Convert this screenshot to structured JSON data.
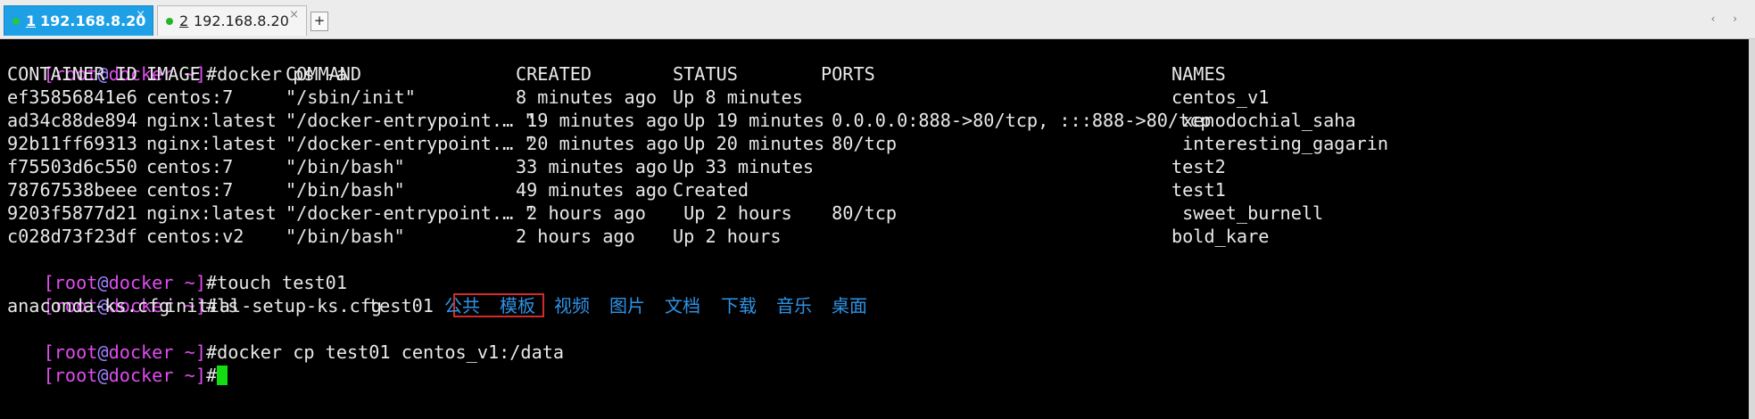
{
  "tabs": [
    {
      "number": "1",
      "host": "192.168.8.20",
      "close": "×"
    },
    {
      "number": "2",
      "host": "192.168.8.20",
      "close": "×"
    }
  ],
  "new_tab": "+",
  "tab_nav": "‹ ›",
  "colors": {
    "prompt": "#e04cf0",
    "dir_listing": "#2e93e6",
    "cursor": "#11dd11",
    "active_tab": "#1ea0e6",
    "highlight_box": "#d42a2a"
  },
  "prompt": {
    "open": "[",
    "user": "root",
    "at": "@",
    "host": "docker",
    "path": " ~",
    "close": "]",
    "sign": "#"
  },
  "commands": {
    "cmd1": "docker ps -a",
    "cmd2": "touch test01",
    "cmd3": "ls",
    "cmd4": "docker cp test01 centos_v1:/data"
  },
  "ps_headers": {
    "id": "CONTAINER ID",
    "image": "IMAGE",
    "command": "COMMAND",
    "created": "CREATED",
    "status": "STATUS",
    "ports": "PORTS",
    "names": "NAMES"
  },
  "ps_rows": [
    {
      "id": "ef35856841e6",
      "image": "centos:7",
      "command": "\"/sbin/init\"",
      "created": "8 minutes ago",
      "status": "Up 8 minutes",
      "ports": "",
      "names": "centos_v1"
    },
    {
      "id": "ad34c88de894",
      "image": "nginx:latest",
      "command": "\"/docker-entrypoint.… \"",
      "created": " 19 minutes ago",
      "status": " Up 19 minutes",
      "ports": " 0.0.0.0:888->80/tcp, :::888->80/tcp",
      "names": " xenodochial_saha"
    },
    {
      "id": "92b11ff69313",
      "image": "nginx:latest",
      "command": "\"/docker-entrypoint.… \"",
      "created": " 20 minutes ago",
      "status": " Up 20 minutes",
      "ports": " 80/tcp",
      "names": " interesting_gagarin"
    },
    {
      "id": "f75503d6c550",
      "image": "centos:7",
      "command": "\"/bin/bash\"",
      "created": "33 minutes ago",
      "status": "Up 33 minutes",
      "ports": "",
      "names": "test2"
    },
    {
      "id": "78767538beee",
      "image": "centos:7",
      "command": "\"/bin/bash\"",
      "created": "49 minutes ago",
      "status": "Created",
      "ports": "",
      "names": "test1"
    },
    {
      "id": "9203f5877d21",
      "image": "nginx:latest",
      "command": "\"/docker-entrypoint.… \"",
      "created": " 2 hours ago",
      "status": " Up 2 hours",
      "ports": " 80/tcp",
      "names": " sweet_burnell"
    },
    {
      "id": "c028d73f23df",
      "image": "centos:v2",
      "command": "\"/bin/bash\"",
      "created": "2 hours ago",
      "status": "Up 2 hours",
      "ports": "",
      "names": "bold_kare"
    }
  ],
  "ls_files": [
    "anaconda-ks.cfg",
    "initial-setup-ks.cfg",
    "test01"
  ],
  "ls_dirs": [
    "公共",
    "模板",
    "视频",
    "图片",
    "文档",
    "下载",
    "音乐",
    "桌面"
  ]
}
